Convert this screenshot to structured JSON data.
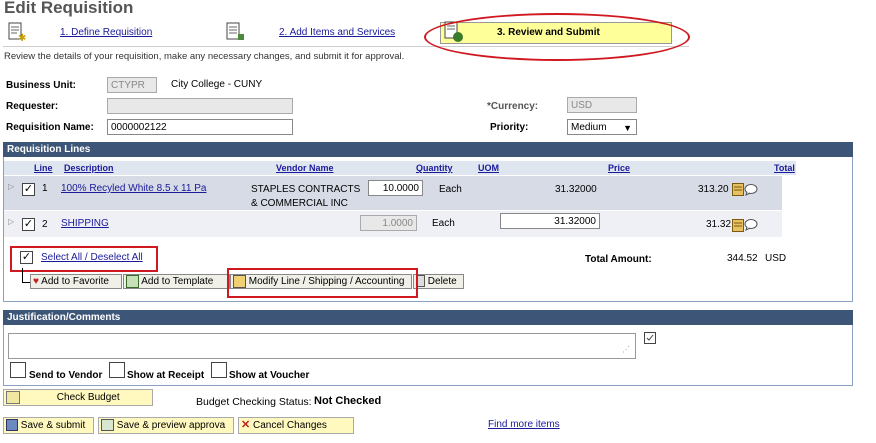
{
  "page_title": "Edit Requisition",
  "steps": [
    {
      "label": "1. Define Requisition"
    },
    {
      "label": "2. Add Items and Services"
    },
    {
      "label": "3. Review and Submit"
    }
  ],
  "intro": "Review the details of your requisition, make any necessary changes, and submit it for approval.",
  "header": {
    "business_unit_label": "Business Unit:",
    "business_unit_value": "CTYPR",
    "business_unit_desc": "City College - CUNY",
    "requester_label": "Requester:",
    "requisition_name_label": "Requisition Name:",
    "requisition_name_value": "0000002122",
    "currency_label": "*Currency:",
    "currency_value": "USD",
    "priority_label": "Priority:",
    "priority_value": "Medium"
  },
  "lines": {
    "title": "Requisition Lines",
    "columns": [
      "Line",
      "Description",
      "Vendor Name",
      "Quantity",
      "UOM",
      "Price",
      "Total"
    ],
    "rows": [
      {
        "line": "1",
        "description": "100% Recyled White 8.5 x 11 Pa",
        "vendor_line1": "STAPLES CONTRACTS",
        "vendor_line2": "& COMMERCIAL INC",
        "quantity": "10.0000",
        "uom": "Each",
        "price": "31.32000",
        "total": "313.20"
      },
      {
        "line": "2",
        "description": "SHIPPING",
        "vendor_line1": "",
        "vendor_line2": "",
        "quantity": "1.0000",
        "uom": "Each",
        "price": "31.32000",
        "total": "31.32"
      }
    ],
    "select_all": "Select All / Deselect All",
    "total_amount_label": "Total Amount:",
    "total_amount_value": "344.52",
    "total_amount_currency": "USD",
    "buttons": {
      "add_favorite": "Add to Favorite",
      "add_template": "Add to Template",
      "modify": "Modify Line / Shipping / Accounting",
      "delete": "Delete"
    }
  },
  "justification": {
    "title": "Justification/Comments",
    "send_to_vendor": "Send to Vendor",
    "show_at_receipt": "Show at Receipt",
    "show_at_voucher": "Show at Voucher"
  },
  "budget": {
    "check_budget": "Check Budget",
    "status_label": "Budget Checking Status:",
    "status_value": "Not Checked"
  },
  "footer": {
    "save_submit": "Save & submit",
    "save_preview": "Save & preview approva",
    "cancel": "Cancel Changes",
    "find_more": "Find more items"
  },
  "colors": {
    "header_bar": "#3d5577",
    "highlight": "#ffff99",
    "annotation_red": "#d01820",
    "link": "#1a1a9a"
  },
  "icons": [
    "document-star-icon",
    "document-add-icon",
    "document-check-icon",
    "expand-arrow-icon",
    "item-detail-icon",
    "comment-icon",
    "heart-add-icon",
    "template-icon",
    "modify-icon",
    "trash-icon",
    "spellcheck-icon",
    "save-icon",
    "preview-icon",
    "cancel-x-icon",
    "budget-check-icon"
  ]
}
